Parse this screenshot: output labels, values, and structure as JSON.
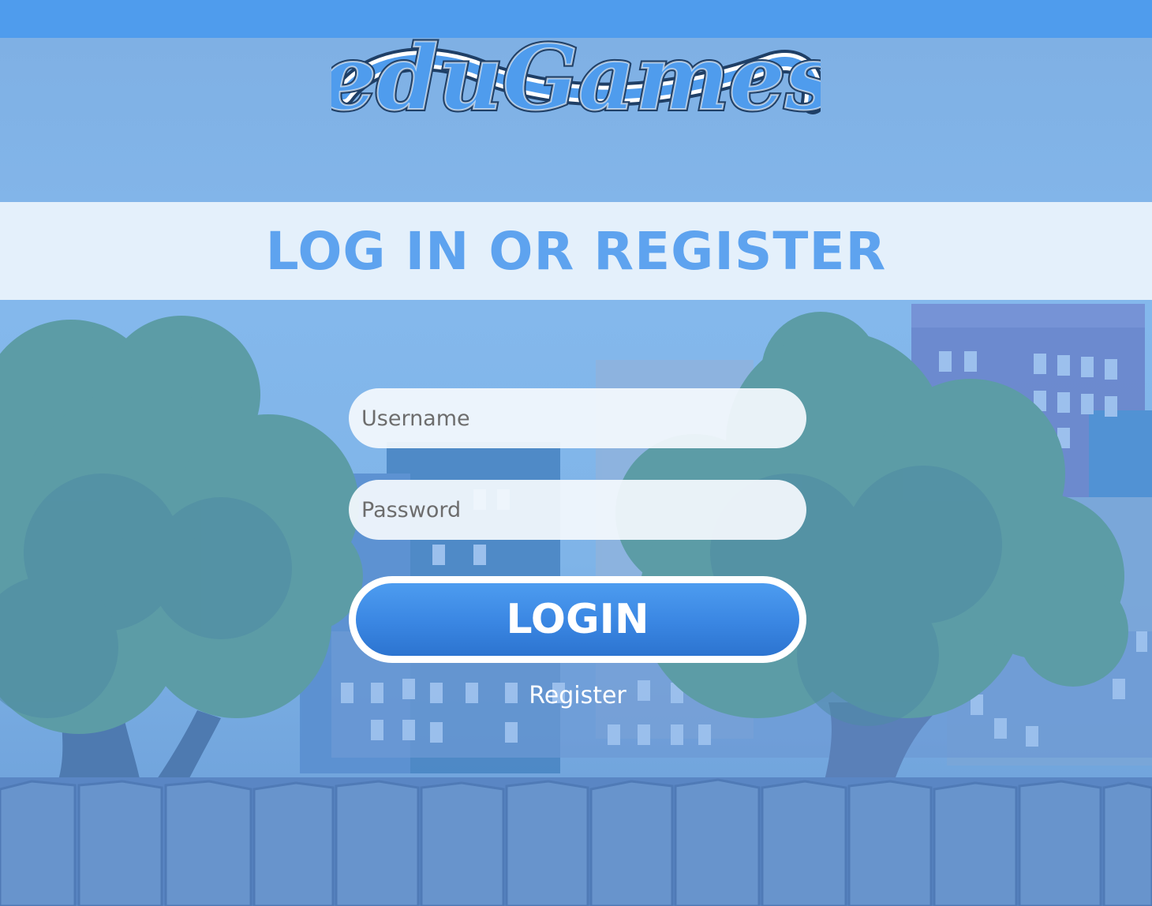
{
  "logo": {
    "text": "eduGames",
    "primary_color": "#4f9ced",
    "outline_color": "#1f3f66"
  },
  "heading": {
    "title": "LOG IN OR REGISTER",
    "color": "#5ea3ef"
  },
  "form": {
    "username_placeholder": "Username",
    "password_placeholder": "Password",
    "login_label": "LOGIN",
    "register_label": "Register"
  },
  "colors": {
    "topbar": "#4f9ced",
    "button": "#3a86e2",
    "banner": "#ecf4fc"
  }
}
